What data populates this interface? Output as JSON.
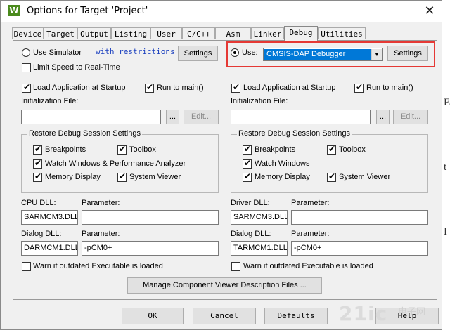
{
  "window": {
    "title": "Options for Target 'Project'",
    "close_glyph": "✕",
    "app_icon": "W"
  },
  "tabs": [
    {
      "label": "Device"
    },
    {
      "label": "Target"
    },
    {
      "label": "Output"
    },
    {
      "label": "Listing"
    },
    {
      "label": "User"
    },
    {
      "label": "C/C++"
    },
    {
      "label": "Asm"
    },
    {
      "label": "Linker"
    },
    {
      "label": "Debug",
      "active": true
    },
    {
      "label": "Utilities"
    }
  ],
  "left": {
    "use_simulator": "Use Simulator",
    "restrictions_link": "with restrictions",
    "settings": "Settings",
    "limit_speed": "Limit Speed to Real-Time",
    "load_app": "Load Application at Startup",
    "run_to_main": "Run to main()",
    "init_file_label": "Initialization File:",
    "browse": "...",
    "edit": "Edit...",
    "restore_group": "Restore Debug Session Settings",
    "breakpoints": "Breakpoints",
    "toolbox": "Toolbox",
    "watch": "Watch Windows & Performance Analyzer",
    "memory": "Memory Display",
    "system_viewer": "System Viewer",
    "cpu_dll_label": "CPU DLL:",
    "parameter_label": "Parameter:",
    "cpu_dll": "SARMCM3.DLL",
    "cpu_param": "",
    "dialog_dll_label": "Dialog DLL:",
    "dialog_dll": "DARMCM1.DLL",
    "dialog_param": "-pCM0+",
    "warn": "Warn if outdated Executable is loaded"
  },
  "right": {
    "use": "Use:",
    "debugger": "CMSIS-DAP Debugger",
    "settings": "Settings",
    "load_app": "Load Application at Startup",
    "run_to_main": "Run to main()",
    "init_file_label": "Initialization File:",
    "browse": "...",
    "edit": "Edit...",
    "restore_group": "Restore Debug Session Settings",
    "breakpoints": "Breakpoints",
    "toolbox": "Toolbox",
    "watch": "Watch Windows",
    "memory": "Memory Display",
    "system_viewer": "System Viewer",
    "driver_dll_label": "Driver DLL:",
    "parameter_label": "Parameter:",
    "driver_dll": "SARMCM3.DLL",
    "driver_param": "",
    "dialog_dll_label": "Dialog DLL:",
    "dialog_dll": "TARMCM1.DLL",
    "dialog_param": "-pCM0+",
    "warn": "Warn if outdated Executable is loaded"
  },
  "manage_button": "Manage Component Viewer Description Files ...",
  "footer": {
    "ok": "OK",
    "cancel": "Cancel",
    "defaults": "Defaults",
    "help": "Help"
  },
  "background_glyphs": [
    "E",
    "t",
    "I"
  ],
  "watermark": {
    "brand": "21ic",
    "cn": "电子网"
  },
  "colors": {
    "highlight_box": "#e53935",
    "selection": "#0078d7",
    "link": "#1a3fbf"
  }
}
